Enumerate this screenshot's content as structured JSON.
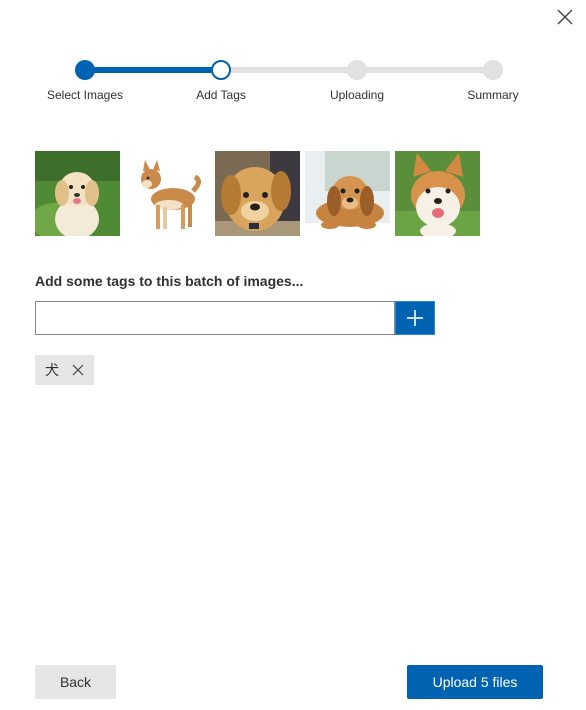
{
  "dialog": {
    "close_icon": "close-icon"
  },
  "stepper": {
    "steps": [
      {
        "label": "Select Images",
        "state": "done"
      },
      {
        "label": "Add Tags",
        "state": "current"
      },
      {
        "label": "Uploading",
        "state": "todo"
      },
      {
        "label": "Summary",
        "state": "todo"
      }
    ],
    "accent_color": "#0063b1",
    "inactive_color": "#e1e1e1"
  },
  "images": {
    "count": 5
  },
  "tags": {
    "heading": "Add some tags to this batch of images...",
    "input_value": "",
    "input_placeholder": "",
    "add_icon": "plus-icon",
    "items": [
      {
        "label": "犬",
        "remove_icon": "close-icon"
      }
    ]
  },
  "footer": {
    "back_label": "Back",
    "upload_label": "Upload 5 files"
  }
}
